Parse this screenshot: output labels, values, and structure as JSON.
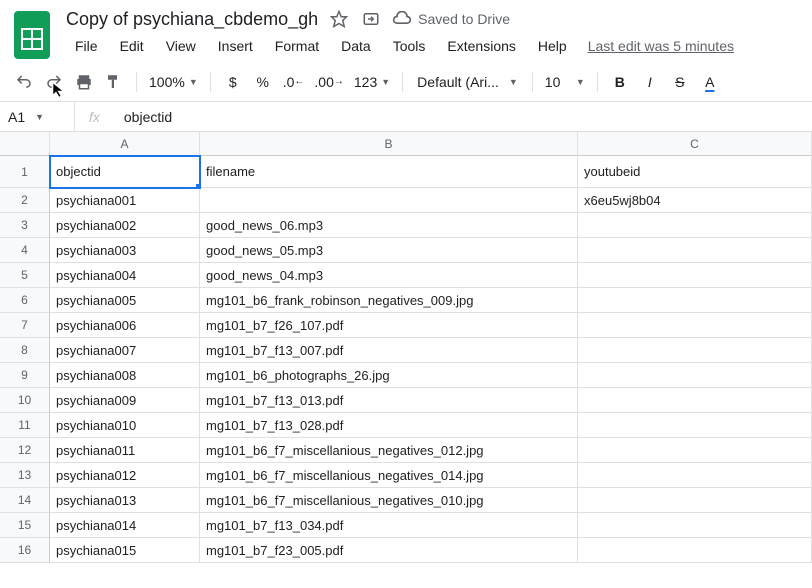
{
  "doc": {
    "title": "Copy of psychiana_cbdemo_gh",
    "saved": "Saved to Drive",
    "last_edit": "Last edit was 5 minutes "
  },
  "menu": {
    "file": "File",
    "edit": "Edit",
    "view": "View",
    "insert": "Insert",
    "format": "Format",
    "data": "Data",
    "tools": "Tools",
    "extensions": "Extensions",
    "help": "Help"
  },
  "toolbar": {
    "zoom": "100%",
    "dollar": "$",
    "percent": "%",
    "dec_dec": ".0",
    "dec_inc": ".00",
    "num_fmt": "123",
    "font": "Default (Ari...",
    "size": "10",
    "bold": "B",
    "italic": "I",
    "strike": "S",
    "text_color": "A"
  },
  "formula": {
    "cell_ref": "A1",
    "fx": "fx",
    "value": "objectid"
  },
  "cols": [
    "A",
    "B",
    "C"
  ],
  "chart_data": {
    "type": "table",
    "title": "Spreadsheet rows",
    "columns": [
      "objectid",
      "filename",
      "youtubeid"
    ],
    "rows": [
      [
        "psychiana001",
        "",
        "x6eu5wj8b04"
      ],
      [
        "psychiana002",
        "good_news_06.mp3",
        ""
      ],
      [
        "psychiana003",
        "good_news_05.mp3",
        ""
      ],
      [
        "psychiana004",
        "good_news_04.mp3",
        ""
      ],
      [
        "psychiana005",
        "mg101_b6_frank_robinson_negatives_009.jpg",
        ""
      ],
      [
        "psychiana006",
        "mg101_b7_f26_107.pdf",
        ""
      ],
      [
        "psychiana007",
        "mg101_b7_f13_007.pdf",
        ""
      ],
      [
        "psychiana008",
        "mg101_b6_photographs_26.jpg",
        ""
      ],
      [
        "psychiana009",
        "mg101_b7_f13_013.pdf",
        ""
      ],
      [
        "psychiana010",
        "mg101_b7_f13_028.pdf",
        ""
      ],
      [
        "psychiana011",
        "mg101_b6_f7_miscellanious_negatives_012.jpg",
        ""
      ],
      [
        "psychiana012",
        "mg101_b6_f7_miscellanious_negatives_014.jpg",
        ""
      ],
      [
        "psychiana013",
        "mg101_b6_f7_miscellanious_negatives_010.jpg",
        ""
      ],
      [
        "psychiana014",
        "mg101_b7_f13_034.pdf",
        ""
      ],
      [
        "psychiana015",
        "mg101_b7_f23_005.pdf",
        ""
      ]
    ]
  },
  "row_numbers": [
    "1",
    "2",
    "3",
    "4",
    "5",
    "6",
    "7",
    "8",
    "9",
    "10",
    "11",
    "12",
    "13",
    "14",
    "15",
    "16"
  ]
}
